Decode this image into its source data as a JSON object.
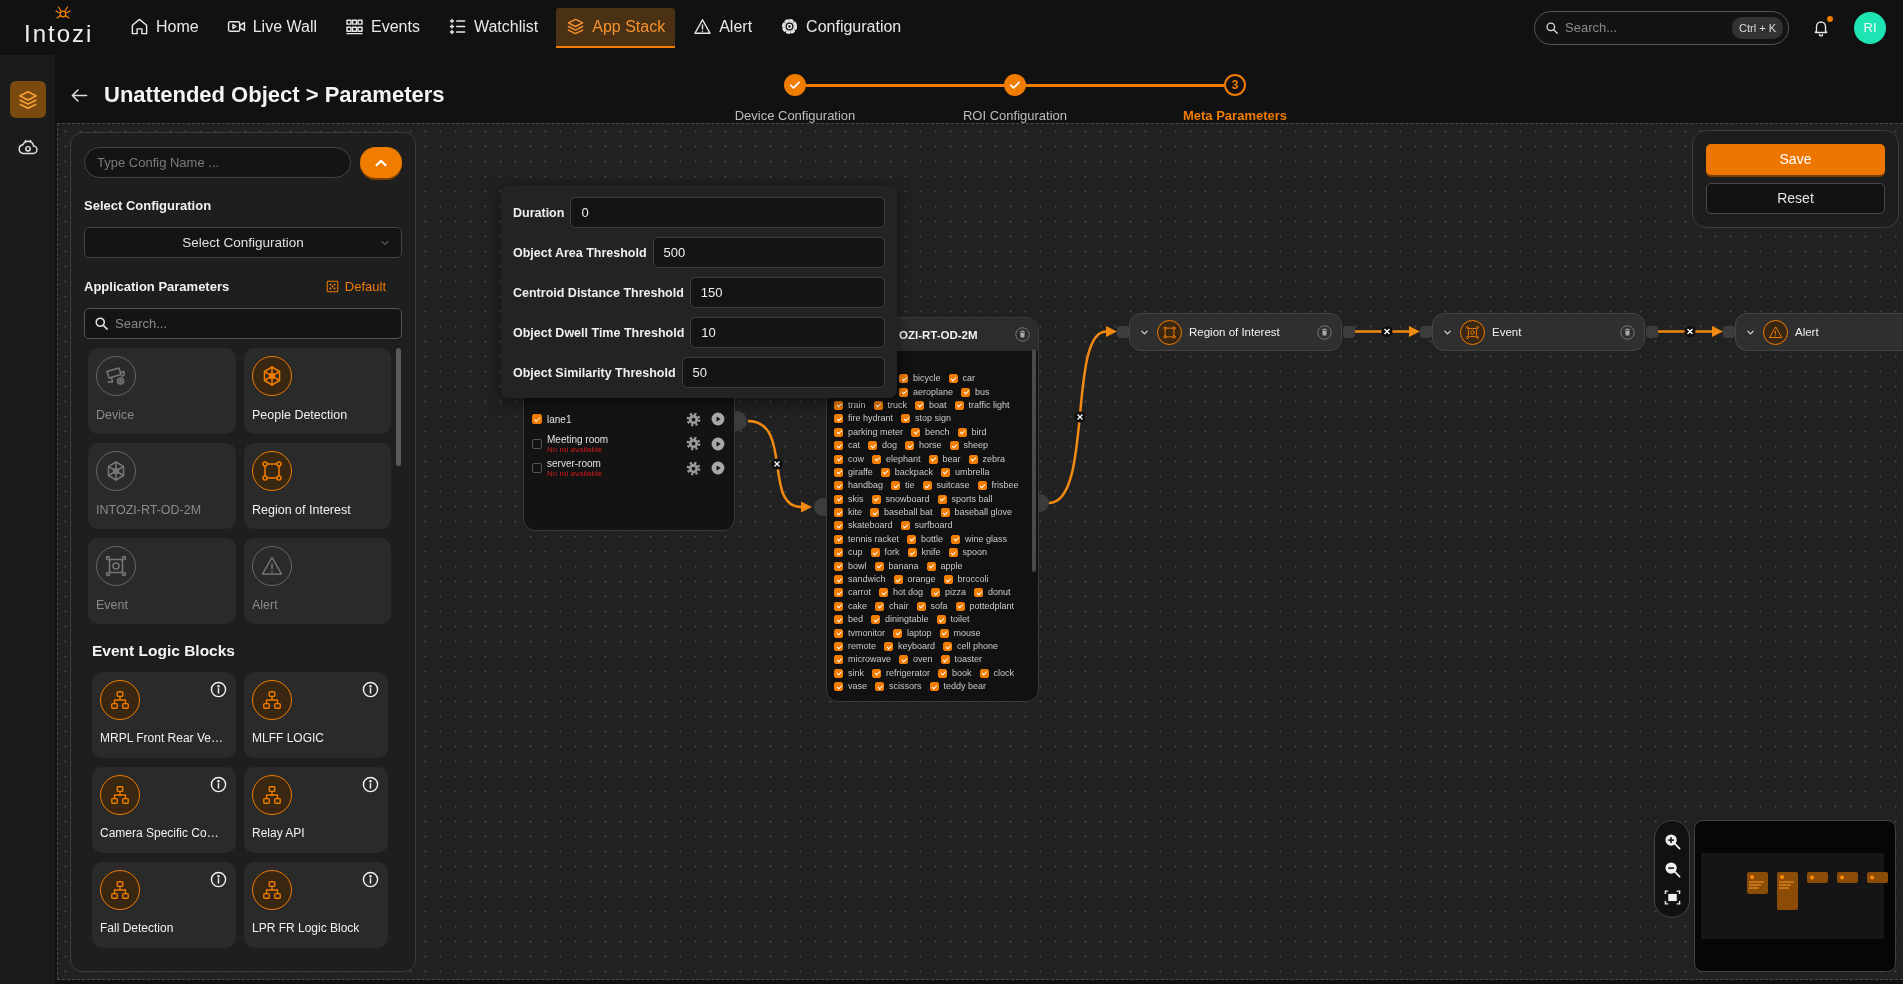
{
  "header": {
    "logo": "Intozi",
    "nav": [
      {
        "label": "Home",
        "kind": "home",
        "selected": false
      },
      {
        "label": "Live Wall",
        "kind": "live",
        "selected": false
      },
      {
        "label": "Events",
        "kind": "events",
        "selected": false
      },
      {
        "label": "Watchlist",
        "kind": "watchlist",
        "selected": false
      },
      {
        "label": "App Stack",
        "kind": "apps",
        "selected": true
      },
      {
        "label": "Alert",
        "kind": "alert",
        "selected": false
      },
      {
        "label": "Configuration",
        "kind": "config",
        "selected": false
      }
    ],
    "search": {
      "placeholder": "Search...",
      "shortcut": "Ctrl + K"
    },
    "notifications": {
      "unread": true
    },
    "avatar": {
      "initials": "RI"
    }
  },
  "rail": [
    {
      "kind": "apps",
      "selected": true
    },
    {
      "kind": "cloud",
      "selected": false
    }
  ],
  "page": {
    "title": "Unattended Object > Parameters",
    "steps": [
      {
        "label": "Device Configuration",
        "done": true,
        "selected": false
      },
      {
        "label": "ROI Configuration",
        "done": true,
        "selected": false
      },
      {
        "label": "Meta Parameters",
        "done": false,
        "selected": true,
        "number": "3"
      }
    ]
  },
  "config_panel": {
    "name_field": {
      "placeholder": "Type Config Name ..."
    },
    "select_label": "Select Configuration",
    "select": {
      "placeholder": "Select Configuration"
    },
    "params_title": "Application Parameters",
    "default_button": "Default",
    "search": {
      "placeholder": "Search..."
    },
    "app_blocks": [
      {
        "label": "Device",
        "kind": "device",
        "disabled": true
      },
      {
        "label": "People Detection",
        "kind": "detection",
        "disabled": false
      },
      {
        "label": "INTOZI-RT-OD-2M",
        "kind": "model",
        "disabled": true
      },
      {
        "label": "Region of Interest",
        "kind": "roi",
        "disabled": false
      },
      {
        "label": "Event",
        "kind": "event",
        "disabled": true
      },
      {
        "label": "Alert",
        "kind": "alert",
        "disabled": true
      }
    ],
    "logic_title": "Event Logic Blocks",
    "logic_blocks": [
      {
        "label": "MRPL Front Rear Ve…"
      },
      {
        "label": "MLFF LOGIC"
      },
      {
        "label": "Camera Specific Co…"
      },
      {
        "label": "Relay API"
      },
      {
        "label": "Fall Detection"
      },
      {
        "label": "LPR FR Logic Block"
      }
    ]
  },
  "canvas": {
    "parameters_popup": {
      "fields": [
        {
          "label": "Duration",
          "value": "0"
        },
        {
          "label": "Object Area Threshold",
          "value": "500"
        },
        {
          "label": "Centroid Distance Threshold",
          "value": "150"
        },
        {
          "label": "Object Dwell Time Threshold",
          "value": "10"
        },
        {
          "label": "Object Similarity Threshold",
          "value": "50"
        }
      ]
    },
    "camera_node": {
      "cameras": [
        {
          "name": "lane1",
          "checked": true
        },
        {
          "name": "Meeting room",
          "checked": false,
          "note": "No roi available"
        },
        {
          "name": "server-room",
          "checked": false,
          "note": "No roi available"
        }
      ]
    },
    "detection_node": {
      "title": "OZI-RT-OD-2M",
      "class_rows": [
        {
          "classes": [
            {
              "label": "bicycle",
              "checked": true
            },
            {
              "label": "car",
              "checked": true
            }
          ]
        },
        {
          "classes": [
            {
              "label": "aeroplane",
              "checked": true
            },
            {
              "label": "bus",
              "checked": true
            }
          ]
        },
        {
          "classes": [
            {
              "label": "train",
              "checked": true
            },
            {
              "label": "truck",
              "checked": true
            },
            {
              "label": "boat",
              "checked": true
            },
            {
              "label": "traffic light",
              "checked": true
            }
          ]
        },
        {
          "classes": [
            {
              "label": "fire hydrant",
              "checked": true
            },
            {
              "label": "stop sign",
              "checked": true
            }
          ]
        },
        {
          "classes": [
            {
              "label": "parking meter",
              "checked": true
            },
            {
              "label": "bench",
              "checked": true
            },
            {
              "label": "bird",
              "checked": true
            }
          ]
        },
        {
          "classes": [
            {
              "label": "cat",
              "checked": true
            },
            {
              "label": "dog",
              "checked": true
            },
            {
              "label": "horse",
              "checked": true
            },
            {
              "label": "sheep",
              "checked": true
            }
          ]
        },
        {
          "classes": [
            {
              "label": "cow",
              "checked": true
            },
            {
              "label": "elephant",
              "checked": true
            },
            {
              "label": "bear",
              "checked": true
            },
            {
              "label": "zebra",
              "checked": true
            }
          ]
        },
        {
          "classes": [
            {
              "label": "giraffe",
              "checked": true
            },
            {
              "label": "backpack",
              "checked": true
            },
            {
              "label": "umbrella",
              "checked": true
            }
          ]
        },
        {
          "classes": [
            {
              "label": "handbag",
              "checked": true
            },
            {
              "label": "tie",
              "checked": true
            },
            {
              "label": "suitcase",
              "checked": true
            },
            {
              "label": "frisbee",
              "checked": true
            }
          ]
        },
        {
          "classes": [
            {
              "label": "skis",
              "checked": true
            },
            {
              "label": "snowboard",
              "checked": true
            },
            {
              "label": "sports ball",
              "checked": true
            }
          ]
        },
        {
          "classes": [
            {
              "label": "kite",
              "checked": true
            },
            {
              "label": "baseball bat",
              "checked": true
            },
            {
              "label": "baseball glove",
              "checked": true
            }
          ]
        },
        {
          "classes": [
            {
              "label": "skateboard",
              "checked": true
            },
            {
              "label": "surfboard",
              "checked": true
            }
          ]
        },
        {
          "classes": [
            {
              "label": "tennis racket",
              "checked": true
            },
            {
              "label": "bottle",
              "checked": true
            },
            {
              "label": "wine glass",
              "checked": true
            }
          ]
        },
        {
          "classes": [
            {
              "label": "cup",
              "checked": true
            },
            {
              "label": "fork",
              "checked": true
            },
            {
              "label": "knife",
              "checked": true
            },
            {
              "label": "spoon",
              "checked": true
            }
          ]
        },
        {
          "classes": [
            {
              "label": "bowl",
              "checked": true
            },
            {
              "label": "banana",
              "checked": true
            },
            {
              "label": "apple",
              "checked": true
            }
          ]
        },
        {
          "classes": [
            {
              "label": "sandwich",
              "checked": true
            },
            {
              "label": "orange",
              "checked": true
            },
            {
              "label": "broccoli",
              "checked": true
            }
          ]
        },
        {
          "classes": [
            {
              "label": "carrot",
              "checked": true
            },
            {
              "label": "hot dog",
              "checked": true
            },
            {
              "label": "pizza",
              "checked": true
            },
            {
              "label": "donut",
              "checked": true
            }
          ]
        },
        {
          "classes": [
            {
              "label": "cake",
              "checked": true
            },
            {
              "label": "chair",
              "checked": true
            },
            {
              "label": "sofa",
              "checked": true
            },
            {
              "label": "pottedplant",
              "checked": true
            }
          ]
        },
        {
          "classes": [
            {
              "label": "bed",
              "checked": true
            },
            {
              "label": "diningtable",
              "checked": true
            },
            {
              "label": "toilet",
              "checked": true
            }
          ]
        },
        {
          "classes": [
            {
              "label": "tvmonitor",
              "checked": true
            },
            {
              "label": "laptop",
              "checked": true
            },
            {
              "label": "mouse",
              "checked": true
            }
          ]
        },
        {
          "classes": [
            {
              "label": "remote",
              "checked": true
            },
            {
              "label": "keyboard",
              "checked": true
            },
            {
              "label": "cell phone",
              "checked": true
            }
          ]
        },
        {
          "classes": [
            {
              "label": "microwave",
              "checked": true
            },
            {
              "label": "oven",
              "checked": true
            },
            {
              "label": "toaster",
              "checked": true
            }
          ]
        },
        {
          "classes": [
            {
              "label": "sink",
              "checked": true
            },
            {
              "label": "refrigerator",
              "checked": true
            },
            {
              "label": "book",
              "checked": true
            },
            {
              "label": "clock",
              "checked": true
            }
          ]
        },
        {
          "classes": [
            {
              "label": "vase",
              "checked": true
            },
            {
              "label": "scissors",
              "checked": true
            },
            {
              "label": "teddy bear",
              "checked": true
            }
          ]
        }
      ]
    },
    "flow_nodes": [
      {
        "label": "Region of Interest",
        "kind": "roi"
      },
      {
        "label": "Event",
        "kind": "event"
      },
      {
        "label": "Alert",
        "kind": "alert"
      }
    ],
    "actions": [
      {
        "label": "Save",
        "kind": "primary"
      },
      {
        "label": "Reset",
        "kind": "secondary"
      }
    ]
  }
}
